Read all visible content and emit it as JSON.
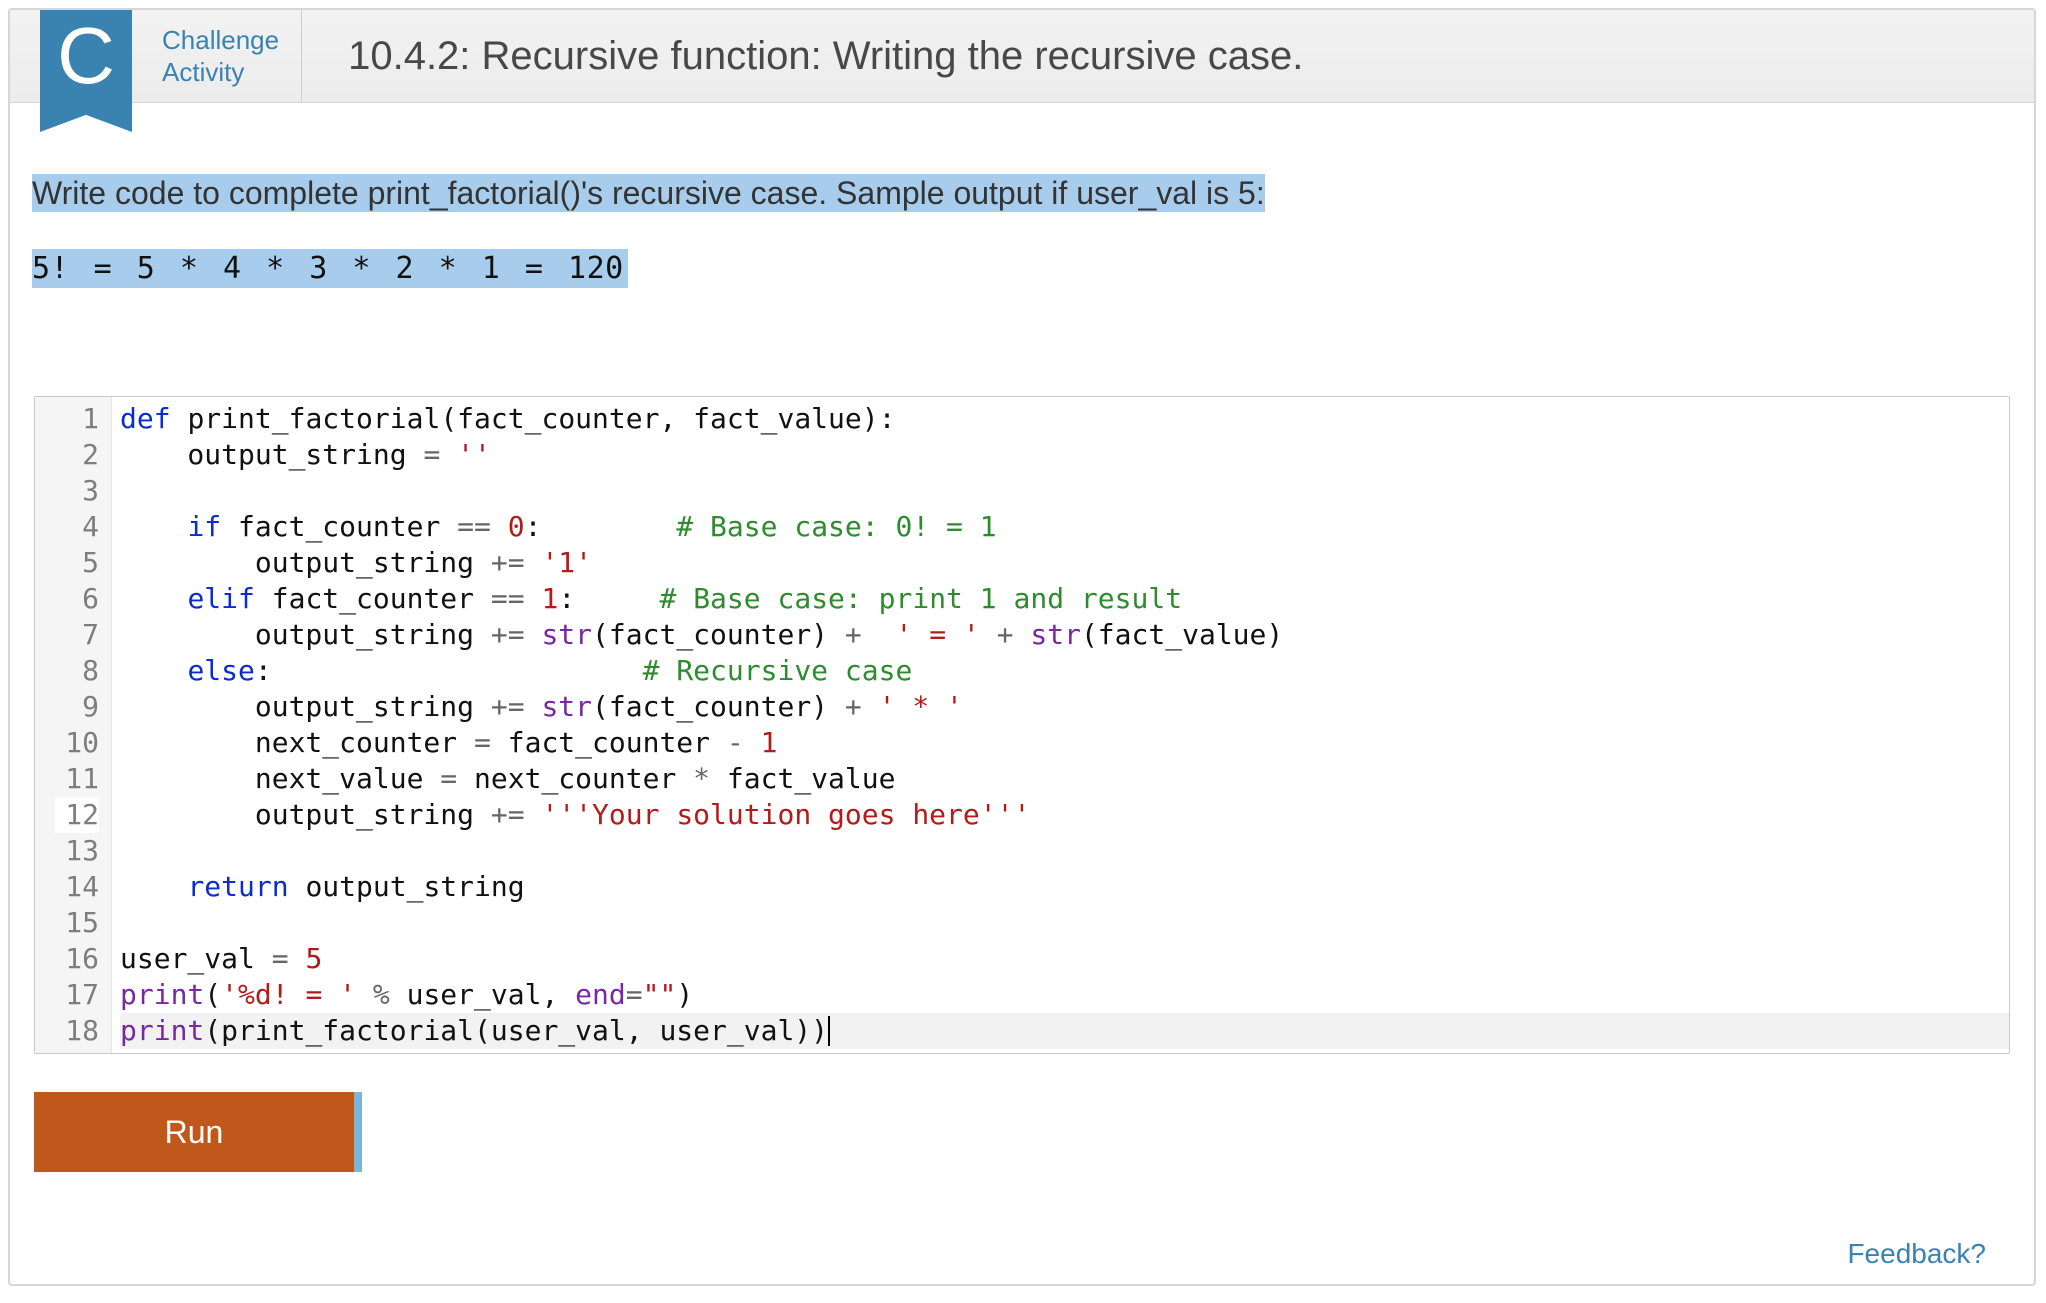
{
  "header": {
    "badge_letter": "C",
    "challenge_line1": "Challenge",
    "challenge_line2": "Activity",
    "title": "10.4.2: Recursive function: Writing the recursive case."
  },
  "prompt": {
    "text": "Write code to complete print_factorial()'s recursive case. Sample output if user_val is 5:",
    "sample_output": "5! = 5 * 4 * 3 * 2 * 1 = 120"
  },
  "editor": {
    "line_count": 18,
    "current_line": 12,
    "highlight_line": 18,
    "code_lines": [
      {
        "n": 1,
        "tokens": [
          [
            "kw",
            "def"
          ],
          [
            "pl",
            " "
          ],
          [
            "fn",
            "print_factorial"
          ],
          [
            "pl",
            "(fact_counter, fact_value):"
          ]
        ]
      },
      {
        "n": 2,
        "tokens": [
          [
            "pl",
            "    output_string "
          ],
          [
            "op",
            "="
          ],
          [
            "pl",
            " "
          ],
          [
            "str",
            "''"
          ]
        ]
      },
      {
        "n": 3,
        "tokens": [
          [
            "pl",
            ""
          ]
        ]
      },
      {
        "n": 4,
        "tokens": [
          [
            "pl",
            "    "
          ],
          [
            "kw",
            "if"
          ],
          [
            "pl",
            " fact_counter "
          ],
          [
            "op",
            "=="
          ],
          [
            "pl",
            " "
          ],
          [
            "num",
            "0"
          ],
          [
            "pl",
            ":        "
          ],
          [
            "cmt",
            "# Base case: 0! = 1"
          ]
        ]
      },
      {
        "n": 5,
        "tokens": [
          [
            "pl",
            "        output_string "
          ],
          [
            "op",
            "+="
          ],
          [
            "pl",
            " "
          ],
          [
            "str",
            "'1'"
          ]
        ]
      },
      {
        "n": 6,
        "tokens": [
          [
            "pl",
            "    "
          ],
          [
            "kw",
            "elif"
          ],
          [
            "pl",
            " fact_counter "
          ],
          [
            "op",
            "=="
          ],
          [
            "pl",
            " "
          ],
          [
            "num",
            "1"
          ],
          [
            "pl",
            ":     "
          ],
          [
            "cmt",
            "# Base case: print 1 and result"
          ]
        ]
      },
      {
        "n": 7,
        "tokens": [
          [
            "pl",
            "        output_string "
          ],
          [
            "op",
            "+="
          ],
          [
            "pl",
            " "
          ],
          [
            "builtin",
            "str"
          ],
          [
            "pl",
            "(fact_counter) "
          ],
          [
            "op",
            "+"
          ],
          [
            "pl",
            "  "
          ],
          [
            "str",
            "' = '"
          ],
          [
            "pl",
            " "
          ],
          [
            "op",
            "+"
          ],
          [
            "pl",
            " "
          ],
          [
            "builtin",
            "str"
          ],
          [
            "pl",
            "(fact_value)"
          ]
        ]
      },
      {
        "n": 8,
        "tokens": [
          [
            "pl",
            "    "
          ],
          [
            "kw",
            "else"
          ],
          [
            "pl",
            ":                      "
          ],
          [
            "cmt",
            "# Recursive case"
          ]
        ]
      },
      {
        "n": 9,
        "tokens": [
          [
            "pl",
            "        output_string "
          ],
          [
            "op",
            "+="
          ],
          [
            "pl",
            " "
          ],
          [
            "builtin",
            "str"
          ],
          [
            "pl",
            "(fact_counter) "
          ],
          [
            "op",
            "+"
          ],
          [
            "pl",
            " "
          ],
          [
            "str",
            "' * '"
          ]
        ]
      },
      {
        "n": 10,
        "tokens": [
          [
            "pl",
            "        next_counter "
          ],
          [
            "op",
            "="
          ],
          [
            "pl",
            " fact_counter "
          ],
          [
            "op",
            "-"
          ],
          [
            "pl",
            " "
          ],
          [
            "num",
            "1"
          ]
        ]
      },
      {
        "n": 11,
        "tokens": [
          [
            "pl",
            "        next_value "
          ],
          [
            "op",
            "="
          ],
          [
            "pl",
            " next_counter "
          ],
          [
            "op",
            "*"
          ],
          [
            "pl",
            " fact_value"
          ]
        ]
      },
      {
        "n": 12,
        "tokens": [
          [
            "pl",
            "        output_string "
          ],
          [
            "op",
            "+="
          ],
          [
            "pl",
            " "
          ],
          [
            "str",
            "'''Your solution goes here'''"
          ]
        ]
      },
      {
        "n": 13,
        "tokens": [
          [
            "pl",
            ""
          ]
        ]
      },
      {
        "n": 14,
        "tokens": [
          [
            "pl",
            "    "
          ],
          [
            "kw",
            "return"
          ],
          [
            "pl",
            " output_string"
          ]
        ]
      },
      {
        "n": 15,
        "tokens": [
          [
            "pl",
            ""
          ]
        ]
      },
      {
        "n": 16,
        "tokens": [
          [
            "pl",
            "user_val "
          ],
          [
            "op",
            "="
          ],
          [
            "pl",
            " "
          ],
          [
            "num",
            "5"
          ]
        ]
      },
      {
        "n": 17,
        "tokens": [
          [
            "builtin",
            "print"
          ],
          [
            "pl",
            "("
          ],
          [
            "str",
            "'%d! = '"
          ],
          [
            "pl",
            " "
          ],
          [
            "op",
            "%"
          ],
          [
            "pl",
            " user_val, "
          ],
          [
            "builtin",
            "end"
          ],
          [
            "op",
            "="
          ],
          [
            "str",
            "\"\""
          ],
          [
            "pl",
            ")"
          ]
        ]
      },
      {
        "n": 18,
        "tokens": [
          [
            "builtin",
            "print"
          ],
          [
            "pl",
            "(print_factorial(user_val, user_val))"
          ],
          [
            "cursor",
            ""
          ]
        ]
      }
    ]
  },
  "buttons": {
    "run": "Run"
  },
  "footer": {
    "feedback": "Feedback?"
  }
}
